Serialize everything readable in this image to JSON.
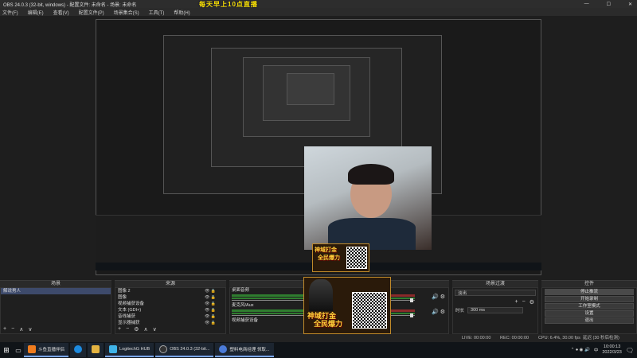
{
  "window": {
    "title": "OBS 24.0.3 (32-bit, windows) - 配置文件: 未命名 - 场景: 未命名",
    "minimize": "—",
    "maximize": "☐",
    "close": "✕"
  },
  "menu": [
    "文件(F)",
    "编辑(E)",
    "查看(V)",
    "配置文件(P)",
    "场景集合(S)",
    "工具(T)",
    "帮助(H)"
  ],
  "overlay_text": "每天早上10点直播",
  "ad": {
    "line1": "神域打金",
    "line2": "全民爆力"
  },
  "panels": {
    "scenes": {
      "title": "场景",
      "items": [
        "解说男人"
      ],
      "tools": [
        "+",
        "−",
        "∧",
        "∨"
      ]
    },
    "sources": {
      "title": "来源",
      "items": [
        "图像 2",
        "图像",
        "视频捕获设备",
        "文本 (GDI+)",
        "音线捕获",
        "显示器捕获"
      ],
      "tools": [
        "+",
        "−",
        "⚙",
        "∧",
        "∨"
      ]
    },
    "mixer": {
      "title": "混音器",
      "rows": [
        {
          "label": "桌面音频"
        },
        {
          "label": "麦克风/Aux"
        },
        {
          "label": "视频捕获设备"
        }
      ]
    },
    "transitions": {
      "title": "场景过渡",
      "mode": "淡出",
      "duration_label": "时长",
      "duration_value": "300 ms",
      "tools": [
        "+",
        "−",
        "⚙"
      ]
    },
    "controls": {
      "title": "控件",
      "buttons": [
        "停止推流",
        "开始录制",
        "工作室模式",
        "设置",
        "退出"
      ]
    }
  },
  "status": {
    "live": "LIVE: 00:00:00",
    "rec": "REC: 00:00:00",
    "cpu": "CPU: 6.4%, 30.00 fps",
    "extra": "延迟 (30 秒后检测)"
  },
  "taskbar": {
    "items": [
      "斗鱼直播伴侣",
      "",
      "",
      "LogitechG HUB",
      "OBS 24.0.3 (32-bit...",
      "塑料电商经理 领取..."
    ],
    "time": "10:00:13",
    "date": "2022/3/23",
    "lang": "中"
  }
}
